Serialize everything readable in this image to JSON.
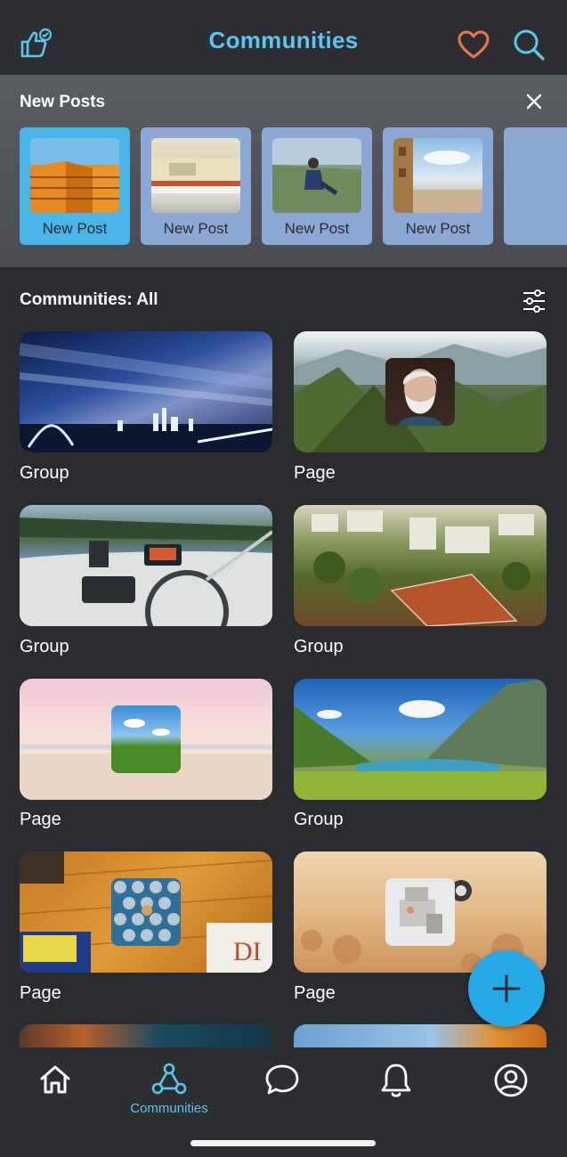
{
  "header": {
    "title": "Communities",
    "like_icon": "thumbs-up-check-icon",
    "favorites_icon": "heart-icon",
    "search_icon": "search-icon"
  },
  "new_posts": {
    "title": "New Posts",
    "close_icon": "close-icon",
    "items": [
      {
        "label": "New Post",
        "thumb": "orange-building"
      },
      {
        "label": "New Post",
        "thumb": "train-motion"
      },
      {
        "label": "New Post",
        "thumb": "person-field"
      },
      {
        "label": "New Post",
        "thumb": "city-tower"
      }
    ]
  },
  "communities": {
    "title": "Communities: All",
    "filter_icon": "filter-sliders-icon",
    "items": [
      {
        "label": "Group",
        "image": "city-night"
      },
      {
        "label": "Page",
        "image": "mountains-bearded-man"
      },
      {
        "label": "Group",
        "image": "boat-helm"
      },
      {
        "label": "Group",
        "image": "aerial-town"
      },
      {
        "label": "Page",
        "image": "pink-sea-field"
      },
      {
        "label": "Group",
        "image": "alpine-lake"
      },
      {
        "label": "Page",
        "image": "desk-shoes"
      },
      {
        "label": "Page",
        "image": "sand-chair"
      }
    ]
  },
  "fab": {
    "icon": "plus-icon"
  },
  "bottom_nav": {
    "items": [
      {
        "icon": "home-icon",
        "label": ""
      },
      {
        "icon": "communities-icon",
        "label": "Communities"
      },
      {
        "icon": "chat-icon",
        "label": ""
      },
      {
        "icon": "bell-icon",
        "label": ""
      },
      {
        "icon": "profile-icon",
        "label": ""
      }
    ]
  },
  "colors": {
    "accent": "#5cc6ee",
    "heart": "#e8774f",
    "fab": "#27a9e8",
    "background": "#2b2c30"
  }
}
